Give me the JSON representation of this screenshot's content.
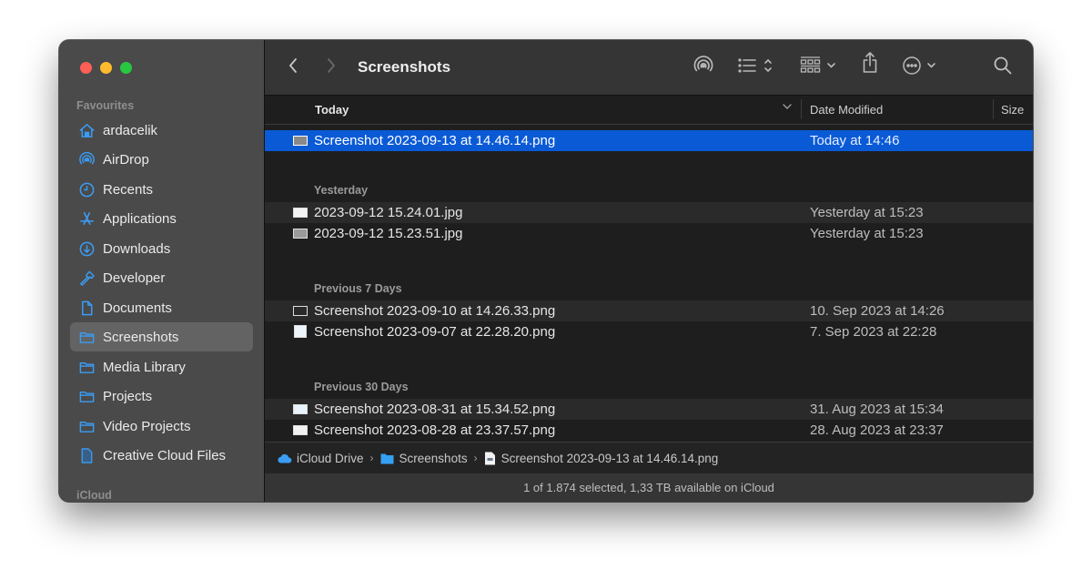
{
  "window": {
    "title": "Screenshots"
  },
  "sidebar": {
    "favourites_label": "Favourites",
    "icloud_label": "iCloud",
    "items": [
      {
        "label": "ardacelik",
        "icon": "home-icon"
      },
      {
        "label": "AirDrop",
        "icon": "airdrop-icon"
      },
      {
        "label": "Recents",
        "icon": "clock-icon"
      },
      {
        "label": "Applications",
        "icon": "applications-icon"
      },
      {
        "label": "Downloads",
        "icon": "download-icon"
      },
      {
        "label": "Developer",
        "icon": "hammer-icon"
      },
      {
        "label": "Documents",
        "icon": "document-icon"
      },
      {
        "label": "Screenshots",
        "icon": "folder-icon",
        "active": true
      },
      {
        "label": "Media Library",
        "icon": "folder-icon"
      },
      {
        "label": "Projects",
        "icon": "folder-icon"
      },
      {
        "label": "Video Projects",
        "icon": "folder-icon"
      },
      {
        "label": "Creative Cloud Files",
        "icon": "file-icon"
      }
    ]
  },
  "toolbar": {
    "back": "back-icon",
    "forward": "forward-icon",
    "airdrop": "airdrop-icon",
    "view": "list-view-icon",
    "group": "group-grid-icon",
    "share": "share-icon",
    "more": "ellipsis-icon",
    "search": "search-icon"
  },
  "columns": {
    "name": "Today",
    "date": "Date Modified",
    "size": "Size"
  },
  "groups": [
    {
      "label": "Today",
      "files": [
        {
          "name": "Screenshot 2023-09-13 at 14.46.14.png",
          "date": "Today at 14:46",
          "selected": true
        }
      ]
    },
    {
      "label": "Yesterday",
      "files": [
        {
          "name": "2023-09-12 15.24.01.jpg",
          "date": "Yesterday at 15:23"
        },
        {
          "name": "2023-09-12 15.23.51.jpg",
          "date": "Yesterday at 15:23"
        }
      ]
    },
    {
      "label": "Previous 7 Days",
      "files": [
        {
          "name": "Screenshot 2023-09-10 at 14.26.33.png",
          "date": "10. Sep 2023 at 14:26"
        },
        {
          "name": "Screenshot 2023-09-07 at 22.28.20.png",
          "date": "7. Sep 2023 at 22:28"
        }
      ]
    },
    {
      "label": "Previous 30 Days",
      "files": [
        {
          "name": "Screenshot 2023-08-31 at 15.34.52.png",
          "date": "31. Aug 2023 at 15:34"
        },
        {
          "name": "Screenshot 2023-08-28 at 23.37.57.png",
          "date": "28. Aug 2023 at 23:37"
        }
      ]
    }
  ],
  "pathbar": {
    "segments": [
      "iCloud Drive",
      "Screenshots",
      "Screenshot 2023-09-13 at 14.46.14.png"
    ]
  },
  "status": {
    "text": "1 of 1.874 selected, 1,33 TB available on iCloud"
  },
  "colors": {
    "accent": "#0a5ad6",
    "sidebar_icon": "#3b9cf3"
  }
}
